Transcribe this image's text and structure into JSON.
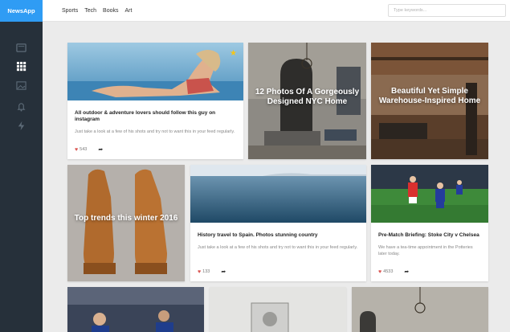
{
  "app": {
    "brand": "NewsApp"
  },
  "nav": {
    "items": [
      "Sports",
      "Tech",
      "Books",
      "Art"
    ]
  },
  "search": {
    "placeholder": "Type keywords..."
  },
  "sidebar": {
    "icons": [
      "list-icon",
      "grid-icon",
      "image-icon",
      "bell-icon",
      "bolt-icon"
    ],
    "active": "grid-icon"
  },
  "cards": {
    "instagram": {
      "title": "All outdoor & adventure lovers should follow this guy on instagram",
      "excerpt": "Just take a look at a few of his shots and try not to want this in your feed regularly.",
      "likes": "543"
    },
    "nyc": {
      "title": "12 Photos Of A Gorgeously Designed NYC Home"
    },
    "warehouse": {
      "title": "Beautiful Yet Simple Warehouse-Inspired Home"
    },
    "trends": {
      "title": "Top trends this winter 2016"
    },
    "spain": {
      "title": "History travel to Spain. Photos stunning country",
      "excerpt": "Just take a look at a few of his shots and try not to want this in your feed regularly.",
      "likes": "133"
    },
    "prematch": {
      "title": "Pre-Match Briefing: Stoke City v Chelsea",
      "excerpt": "We have a tea-time appointment in the Potteries later today.",
      "likes": "4533"
    }
  },
  "colors": {
    "brand": "#2f9cf4",
    "sidebar": "#26303a",
    "heart": "#d9534f",
    "star": "#f5c518"
  }
}
